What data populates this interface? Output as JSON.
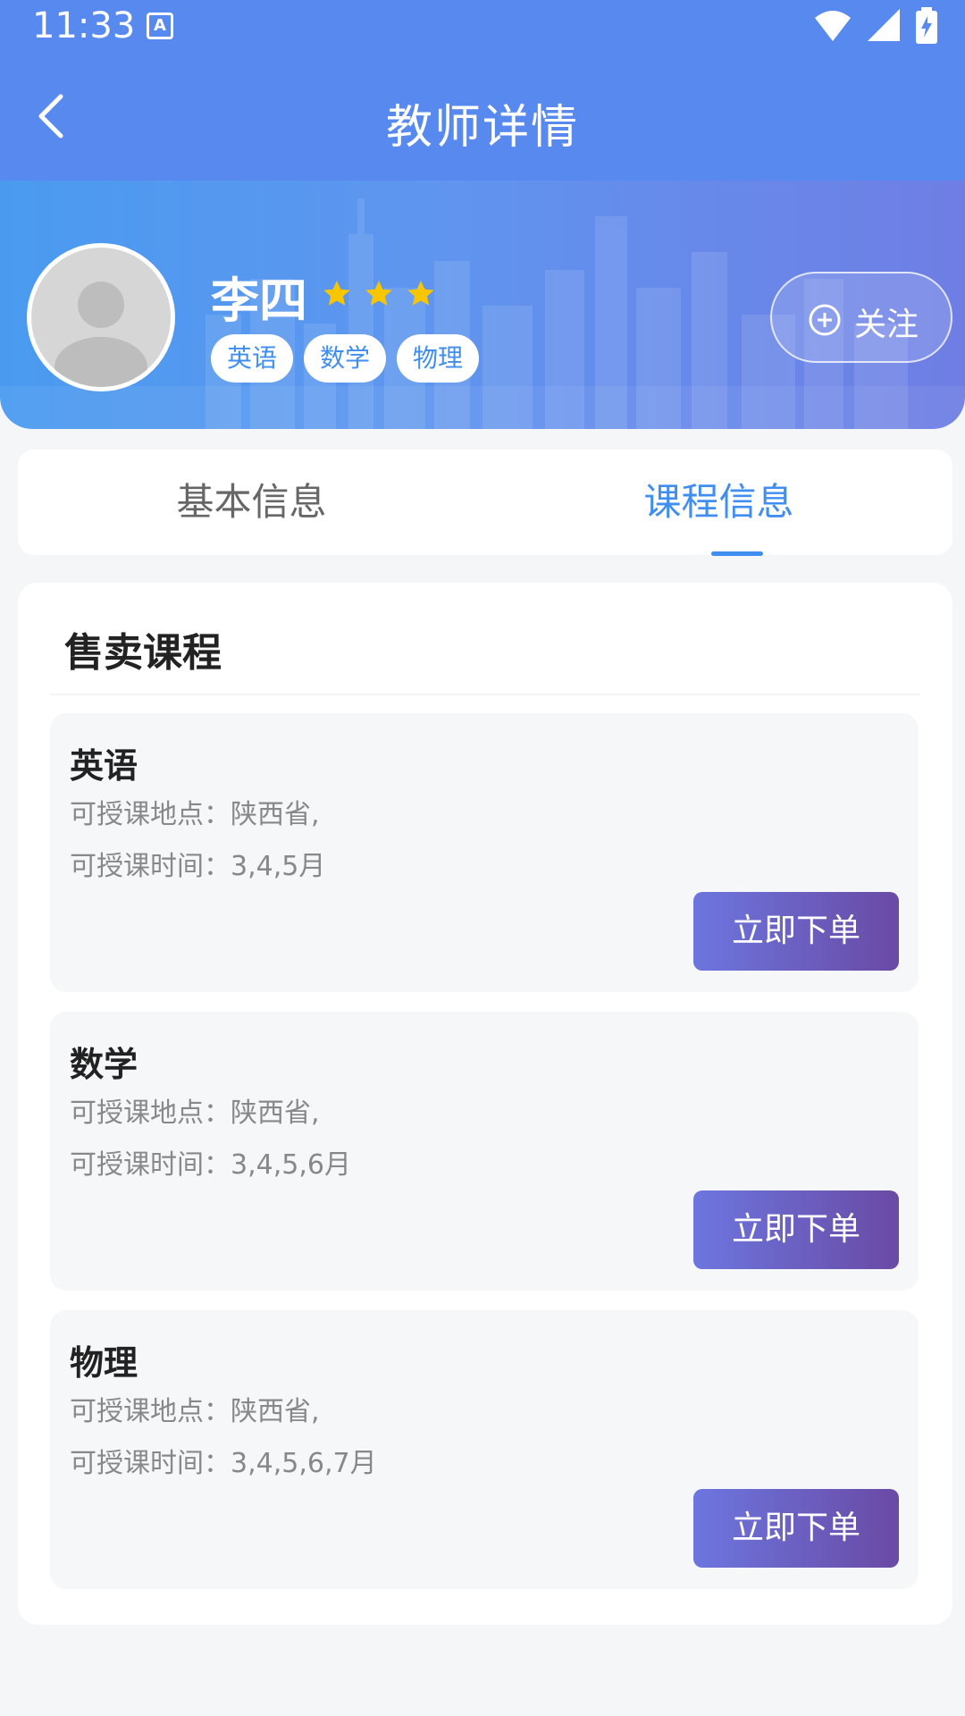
{
  "status": {
    "time": "11:33",
    "icon_a": "A",
    "wifi_icon": "wifi-icon",
    "signal_icon": "signal-icon",
    "battery_icon": "battery-charging-icon"
  },
  "header": {
    "title": "教师详情",
    "back_icon": "back-arrow-icon"
  },
  "teacher": {
    "name": "李四",
    "rating": 3,
    "star_color": "#f7c600",
    "subjects": [
      "英语",
      "数学",
      "物理"
    ],
    "follow_label": "关注",
    "follow_icon": "plus-circle-icon"
  },
  "tabs": [
    {
      "label": "基本信息",
      "active": false
    },
    {
      "label": "课程信息",
      "active": true
    }
  ],
  "courses_section": {
    "title": "售卖课程",
    "courses": [
      {
        "name": "英语",
        "location": "可授课地点：陕西省,",
        "time": "可授课时间：3,4,5月",
        "button": "立即下单"
      },
      {
        "name": "数学",
        "location": "可授课地点：陕西省,",
        "time": "可授课时间：3,4,5,6月",
        "button": "立即下单"
      },
      {
        "name": "物理",
        "location": "可授课地点：陕西省,",
        "time": "可授课时间：3,4,5,6,7月",
        "button": "立即下单"
      }
    ]
  },
  "colors": {
    "primary": "#5789ee",
    "accent": "#3f8ef0",
    "button_start": "#6c76df",
    "button_end": "#6a4aa4"
  }
}
